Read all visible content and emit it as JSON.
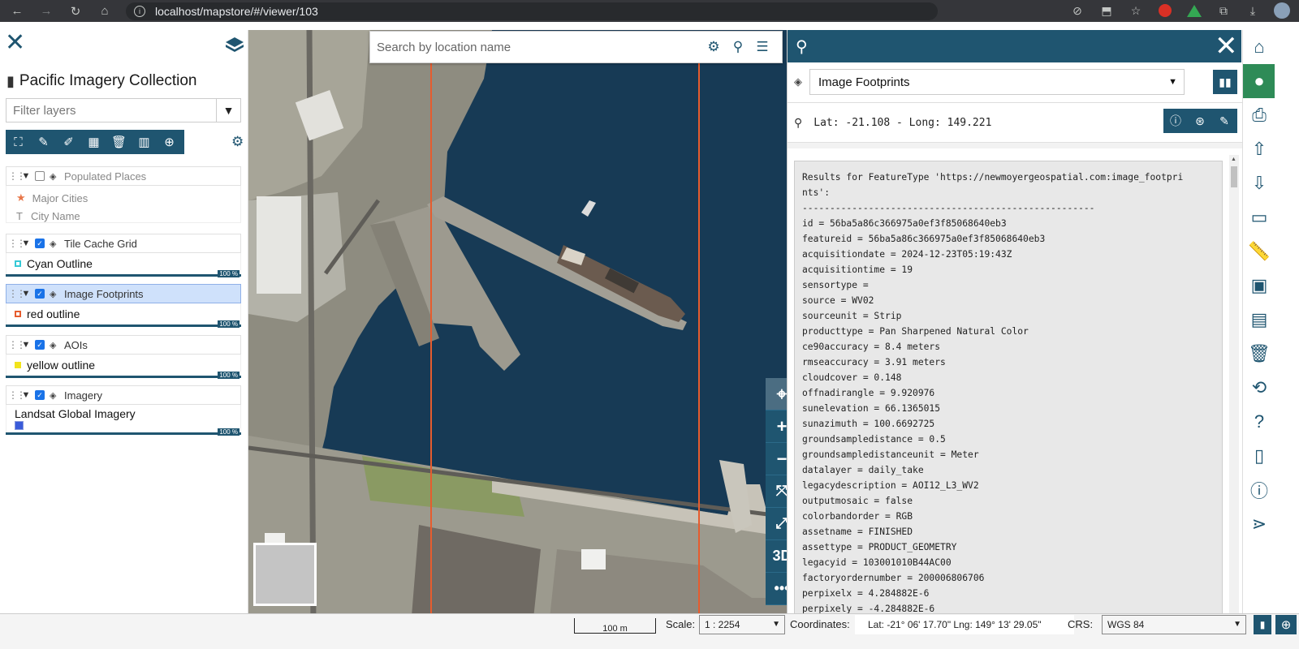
{
  "browser": {
    "url": "localhost/mapstore/#/viewer/103"
  },
  "left_panel": {
    "title": "Pacific Imagery Collection",
    "filter_placeholder": "Filter layers",
    "layers": [
      {
        "name": "Populated Places",
        "checked": false,
        "legend": [
          {
            "label": "Major Cities",
            "symbol": "star"
          },
          {
            "label": "City Name",
            "symbol": "T"
          }
        ]
      },
      {
        "name": "Tile Cache Grid",
        "checked": true,
        "legend": [
          {
            "label": "Cyan Outline",
            "color": "#36c9d6"
          }
        ],
        "opacity": "100 %"
      },
      {
        "name": "Image Footprints",
        "checked": true,
        "selected": true,
        "legend": [
          {
            "label": "red outline",
            "color": "#e65c2e"
          }
        ],
        "opacity": "100 %"
      },
      {
        "name": "AOIs",
        "checked": true,
        "legend": [
          {
            "label": "yellow outline",
            "color": "#f2e41c"
          }
        ],
        "opacity": "100 %"
      },
      {
        "name": "Imagery",
        "checked": true,
        "legend": [
          {
            "label": "Landsat Global Imagery",
            "color": "#3a5bd9"
          }
        ],
        "opacity": "100 %"
      }
    ]
  },
  "search": {
    "placeholder": "Search by location name"
  },
  "map_controls": {
    "three_d_label": "3D",
    "more_label": "•••"
  },
  "identify": {
    "selected_layer": "Image Footprints",
    "coordinates": "Lat: -21.108 - Long: 149.221",
    "results": [
      "Results for FeatureType 'https://newmoyergeospatial.com:image_footpri",
      "nts':",
      "-----------------------------------------------------",
      "id = 56ba5a86c366975a0ef3f85068640eb3",
      "featureid = 56ba5a86c366975a0ef3f85068640eb3",
      "acquisitiondate = 2024-12-23T05:19:43Z",
      "acquisitiontime = 19",
      "sensortype =",
      "source = WV02",
      "sourceunit = Strip",
      "producttype = Pan Sharpened Natural Color",
      "ce90accuracy = 8.4 meters",
      "rmseaccuracy = 3.91 meters",
      "cloudcover = 0.148",
      "offnadirangle = 9.920976",
      "sunelevation = 66.1365015",
      "sunazimuth = 100.6692725",
      "groundsampledistance = 0.5",
      "groundsampledistanceunit = Meter",
      "datalayer = daily_take",
      "legacydescription = AOI12_L3_WV2",
      "outputmosaic = false",
      "colorbandorder = RGB",
      "assetname = FINISHED",
      "assettype = PRODUCT_GEOMETRY",
      "legacyid = 103001010B44AC00",
      "factoryordernumber = 200006806706",
      "perpixelx = 4.284882E-6",
      "perpixely = -4.284882E-6"
    ]
  },
  "footer": {
    "scalebar_label": "100 m",
    "scale_label": "Scale:",
    "scale_value": "1 : 2254",
    "coordinates_label": "Coordinates:",
    "coordinates_value": "Lat: -21° 06' 17.70\" Lng: 149° 13' 29.05\"",
    "crs_label": "CRS:",
    "crs_value": "WGS 84"
  },
  "colors": {
    "primary": "#1f5570",
    "active_green": "#2e8b57",
    "footprint_red": "#e65c2e"
  }
}
